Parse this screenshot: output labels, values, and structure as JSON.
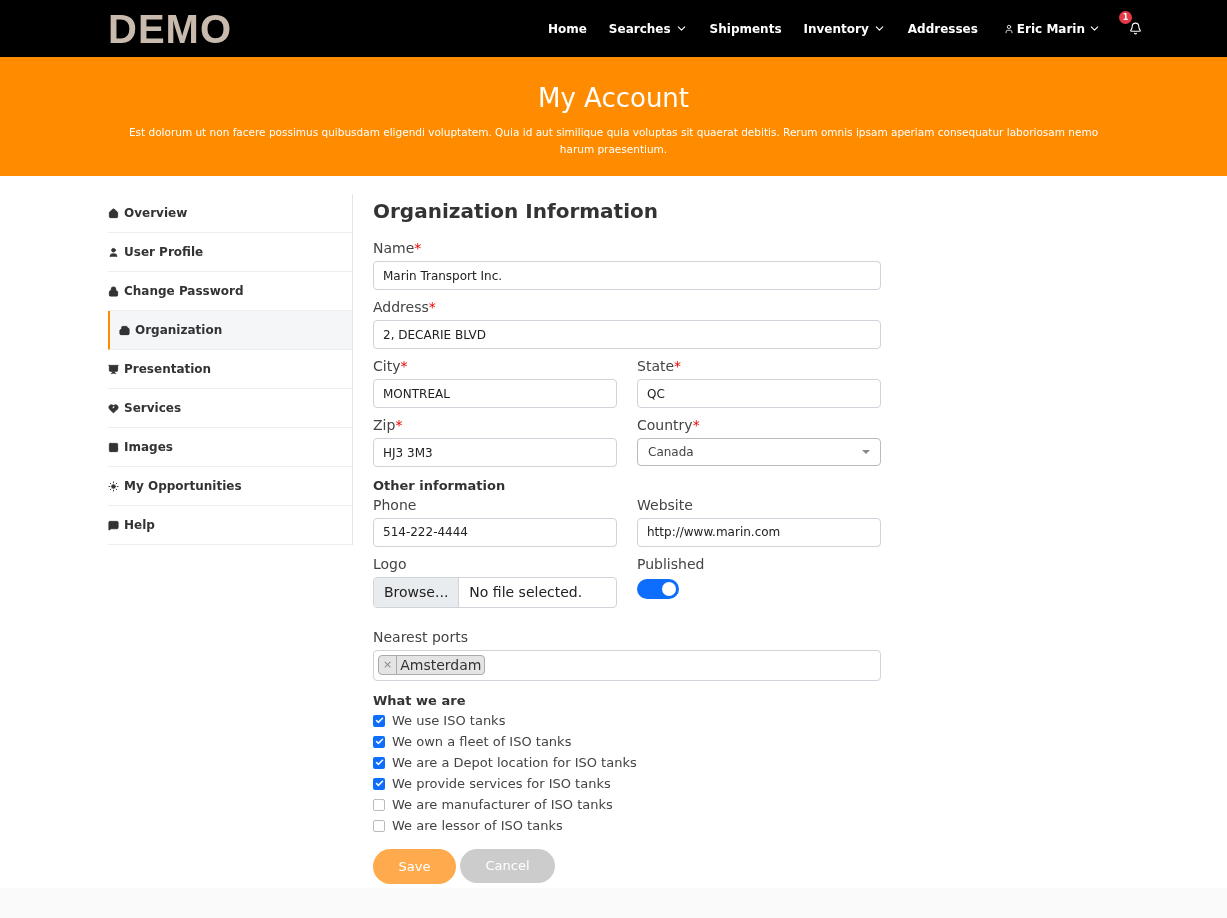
{
  "brand": "DEMO",
  "nav": [
    {
      "label": "Home",
      "dropdown": false
    },
    {
      "label": "Searches",
      "dropdown": true
    },
    {
      "label": "Shipments",
      "dropdown": false
    },
    {
      "label": "Inventory",
      "dropdown": true
    },
    {
      "label": "Addresses",
      "dropdown": false
    }
  ],
  "user": {
    "name": "Eric Marin"
  },
  "notifications": {
    "count": "1"
  },
  "banner": {
    "title": "My Account",
    "text": "Est dolorum ut non facere possimus quibusdam eligendi voluptatem. Quia id aut similique quia voluptas sit quaerat debitis. Rerum omnis ipsam aperiam consequatur laboriosam nemo harum praesentium."
  },
  "sidebar": {
    "items": [
      {
        "label": "Overview",
        "selected": false
      },
      {
        "label": "User Profile",
        "selected": false
      },
      {
        "label": "Change Password",
        "selected": false
      },
      {
        "label": "Organization",
        "selected": true
      },
      {
        "label": "Presentation",
        "selected": false
      },
      {
        "label": "Services",
        "selected": false
      },
      {
        "label": "Images",
        "selected": false
      },
      {
        "label": "My Opportunities",
        "selected": false
      },
      {
        "label": "Help",
        "selected": false
      }
    ]
  },
  "form": {
    "title": "Organization Information",
    "rows": [
      {
        "kind": "fields",
        "fields": [
          {
            "kind": "text",
            "label": "Name",
            "mark": "*",
            "value": "Marin Transport Inc."
          }
        ]
      },
      {
        "kind": "fields",
        "fields": [
          {
            "kind": "text",
            "label": "Address",
            "mark": "*",
            "value": "2, DECARIE BLVD"
          }
        ]
      },
      {
        "kind": "fields",
        "fields": [
          {
            "kind": "text",
            "label": "City",
            "mark": "*",
            "value": "MONTREAL"
          },
          {
            "kind": "text",
            "label": "State",
            "mark": "*",
            "value": "QC"
          }
        ]
      },
      {
        "kind": "fields",
        "fields": [
          {
            "kind": "text",
            "label": "Zip",
            "mark": "*",
            "value": "HJ3 3M3"
          },
          {
            "kind": "select",
            "label": "Country",
            "mark": "*",
            "value": "Canada"
          }
        ]
      },
      {
        "kind": "heading",
        "text": "Other information"
      },
      {
        "kind": "fields",
        "fields": [
          {
            "kind": "text",
            "label": "Phone",
            "value": "514-222-4444"
          },
          {
            "kind": "text",
            "label": "Website",
            "value": "http://www.marin.com"
          }
        ]
      },
      {
        "kind": "fields",
        "fields": [
          {
            "kind": "file",
            "label": "Logo",
            "button": "Browse...",
            "value": "No file selected."
          },
          {
            "kind": "toggle",
            "label": "Published",
            "on": true
          }
        ]
      },
      {
        "kind": "fields",
        "fields": [
          {
            "kind": "tags",
            "label": "Nearest ports",
            "remove": "×",
            "tags": [
              "Amsterdam"
            ]
          }
        ]
      }
    ],
    "checks_title": "What we are",
    "checks": [
      {
        "label": "We use ISO tanks",
        "checked": true
      },
      {
        "label": "We own a fleet of ISO tanks",
        "checked": true
      },
      {
        "label": "We are a Depot location for ISO tanks",
        "checked": true
      },
      {
        "label": "We provide services for ISO tanks",
        "checked": true
      },
      {
        "label": "We are manufacturer of ISO tanks",
        "checked": false
      },
      {
        "label": "We are lessor of ISO tanks",
        "checked": false
      }
    ],
    "save": "Save",
    "cancel": "Cancel"
  }
}
